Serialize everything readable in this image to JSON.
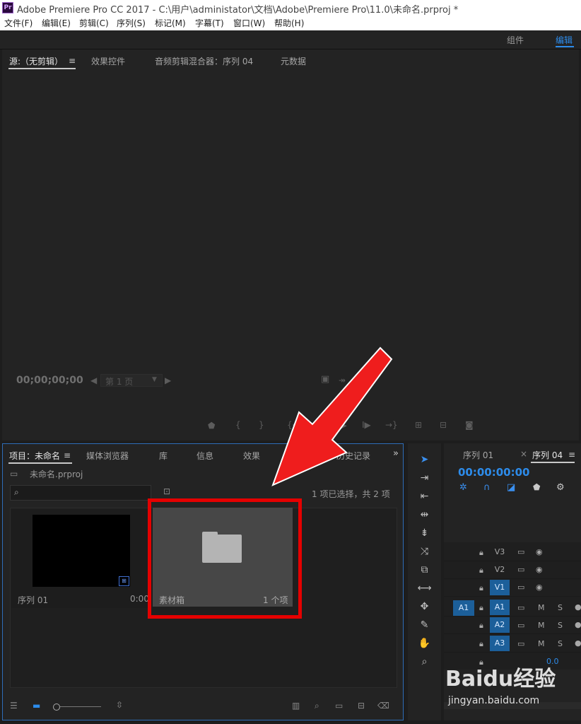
{
  "titlebar": {
    "logo": "Pr",
    "title": "Adobe Premiere Pro CC 2017 - C:\\用户\\administator\\文档\\Adobe\\Premiere Pro\\11.0\\未命名.prproj *"
  },
  "menu": [
    "文件(F)",
    "编辑(E)",
    "剪辑(C)",
    "序列(S)",
    "标记(M)",
    "字幕(T)",
    "窗口(W)",
    "帮助(H)"
  ],
  "workspaces": {
    "components": "组件",
    "edit": "编辑"
  },
  "source_panel": {
    "tabs": [
      "源:（无剪辑）",
      "效果控件",
      "音频剪辑混合器：序列 04",
      "元数据"
    ],
    "menu_icon": "hamburger-icon",
    "timecode": "00;00;00;00",
    "page_select": "第 1 页"
  },
  "project_panel": {
    "tabs": [
      "项目：未命名",
      "媒体浏览器",
      "库",
      "信息",
      "效果",
      "历史记录"
    ],
    "file_name": "未命名.prproj",
    "search_placeholder": "",
    "selection_status": "1 项已选择，共 2 项",
    "items": [
      {
        "name": "序列 01",
        "duration": "0:00"
      },
      {
        "name": "素材箱",
        "count": "1 个项"
      }
    ]
  },
  "timeline": {
    "tabs": [
      "序列 01",
      "序列 04"
    ],
    "timecode": "00:00:00:00",
    "video_tracks": [
      "V3",
      "V2",
      "V1"
    ],
    "audio_tracks": [
      "A1",
      "A2",
      "A3"
    ],
    "source_patch": "A1",
    "mix_value": "0.0",
    "mute_label": "M",
    "solo_label": "S"
  },
  "watermark": {
    "brand": "Baidu经验",
    "url": "jingyan.baidu.com"
  },
  "colors": {
    "accent_blue": "#2d8ceb",
    "highlight_red": "#e50000",
    "panel_bg": "#232323"
  }
}
